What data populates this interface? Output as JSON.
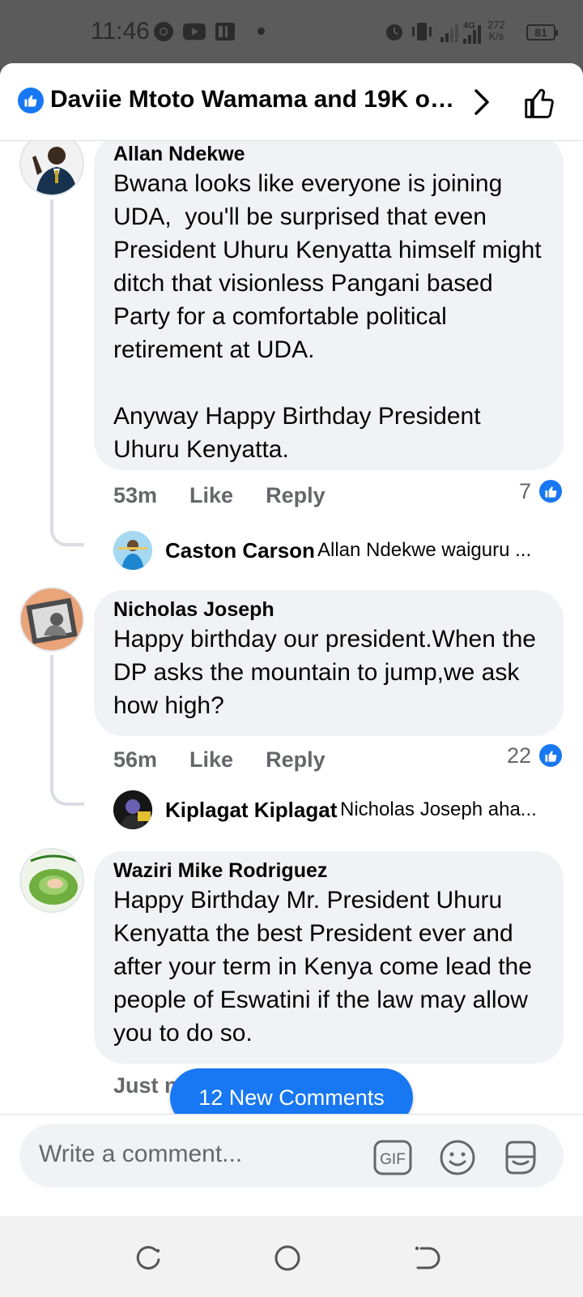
{
  "status": {
    "time": "11:46",
    "network_label": "4G",
    "speed": "272",
    "speed_unit": "K/s",
    "battery": "81"
  },
  "header": {
    "title": "Daviie Mtoto Wamama and 19K o…"
  },
  "comments": [
    {
      "author": "Allan Ndekwe",
      "text": "Bwana looks like everyone is joining UDA,  you'll be surprised that even President Uhuru Kenyatta himself might ditch that visionless Pangani based Party for a comfortable political retirement at UDA.\n\nAnyway Happy Birthday President Uhuru Kenyatta.",
      "time": "53m",
      "like": "Like",
      "reply": "Reply",
      "reactions": "7",
      "reply_preview": {
        "author": "Caston Carson",
        "text": "Allan Ndekwe waiguru ..."
      }
    },
    {
      "author": "Nicholas Joseph",
      "text": "Happy birthday our president.When the DP asks the mountain to jump,we ask how high?",
      "time": "56m",
      "like": "Like",
      "reply": "Reply",
      "reactions": "22",
      "reply_preview": {
        "author": "Kiplagat Kiplagat",
        "text": "Nicholas Joseph aha..."
      }
    },
    {
      "author": "Waziri Mike Rodriguez",
      "text": "Happy Birthday Mr. President Uhuru Kenyatta the best President ever and after your term in Kenya come lead the people of Eswatini if the law may allow you to do so.",
      "time": "Just n"
    }
  ],
  "new_comments_label": "12 New Comments",
  "composer": {
    "placeholder": "Write a comment...",
    "gif_label": "GIF"
  },
  "colors": {
    "accent": "#1877f2",
    "bubble": "#f0f2f5",
    "muted": "#65676b"
  }
}
